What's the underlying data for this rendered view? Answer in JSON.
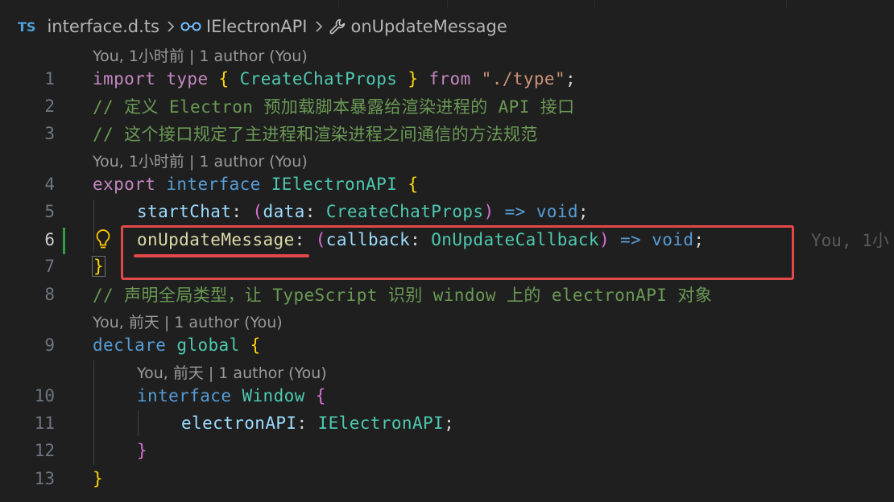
{
  "breadcrumb": {
    "lang_badge": "TS",
    "file": "interface.d.ts",
    "interface": "IElectronAPI",
    "method": "onUpdateMessage"
  },
  "lenses": {
    "l1": "You, 1小时前 | 1 author (You)",
    "l4": "You, 1小时前 | 1 author (You)",
    "l9": "You, 前天 | 1 author (You)",
    "l10": "You, 前天 | 1 author (You)"
  },
  "line_numbers": [
    "1",
    "2",
    "3",
    "4",
    "5",
    "6",
    "7",
    "8",
    "9",
    "10",
    "11",
    "12",
    "13"
  ],
  "code": {
    "l1": {
      "import": "import",
      "type": "type",
      "ob": "{",
      "name": "CreateChatProps",
      "cb": "}",
      "from": "from",
      "path": "\"./type\"",
      "semi": ";"
    },
    "l2": "// 定义 Electron 预加载脚本暴露给渲染进程的 API 接口",
    "l3": "// 这个接口规定了主进程和渲染进程之间通信的方法规范",
    "l4": {
      "export": "export",
      "interface": "interface",
      "name": "IElectronAPI",
      "ob": "{"
    },
    "l5": {
      "prop": "startChat",
      "colon": ":",
      "op": "(",
      "param": "data",
      "pcolon": ":",
      "ptype": "CreateChatProps",
      "cp": ")",
      "arrow": "=>",
      "ret": "void",
      "semi": ";"
    },
    "l6": {
      "prop": "onUpdateMessage",
      "colon": ":",
      "op": "(",
      "param": "callback",
      "pcolon": ":",
      "ptype": "OnUpdateCallback",
      "cp": ")",
      "arrow": "=>",
      "ret": "void",
      "semi": ";",
      "blame": "You, 1小"
    },
    "l7": "}",
    "l8": "// 声明全局类型，让 TypeScript 识别 window 上的 electronAPI 对象",
    "l9": {
      "declare": "declare",
      "global": "global",
      "ob": "{"
    },
    "l10": {
      "interface": "interface",
      "name": "Window",
      "ob": "{"
    },
    "l11": {
      "prop": "electronAPI",
      "colon": ":",
      "type": "IElectronAPI",
      "semi": ";"
    },
    "l12": "}",
    "l13": "}"
  },
  "colors": {
    "background": "#1f1f1f",
    "highlight_box": "#e34848",
    "git_modified": "#2ea043"
  },
  "icons": {
    "symbol_interface": "interface-symbol-icon",
    "symbol_method": "wrench-method-icon",
    "code_action": "lightbulb-icon"
  }
}
